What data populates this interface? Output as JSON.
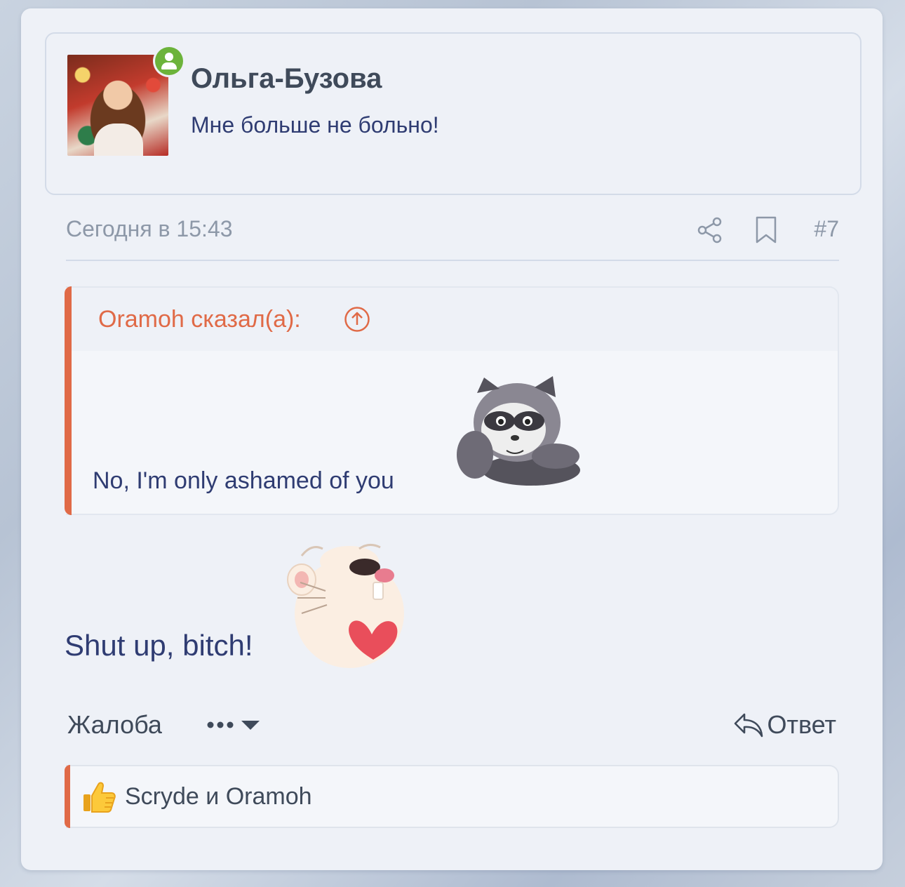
{
  "author": {
    "name": "Ольга-Бузова",
    "status": "Мне больше не больно!",
    "online_badge_icon": "user-online-icon"
  },
  "meta": {
    "date": "Сегодня в 15:43",
    "post_number": "#7",
    "share_icon": "share-icon",
    "bookmark_icon": "bookmark-icon"
  },
  "quote": {
    "author_label": "Oramoh сказал(а):",
    "jump_icon": "arrow-up-circle-icon",
    "text": "No, I'm only ashamed of you",
    "sticker": "raccoon-sticker"
  },
  "post": {
    "text": "Shut up, bitch!",
    "sticker": "hamster-heart-sticker"
  },
  "actions": {
    "report_label": "Жалоба",
    "more_icon": "more-dots-icon",
    "reply_label": "Ответ",
    "reply_icon": "reply-arrow-icon"
  },
  "reactions": {
    "icon": "thumbs-up-icon",
    "text": "Scryde и Oramoh"
  },
  "colors": {
    "accent": "#e06a47",
    "text_primary": "#2f3c72",
    "text_muted": "#8d98a8",
    "online": "#6cb33b",
    "card_bg": "#eef1f7"
  }
}
